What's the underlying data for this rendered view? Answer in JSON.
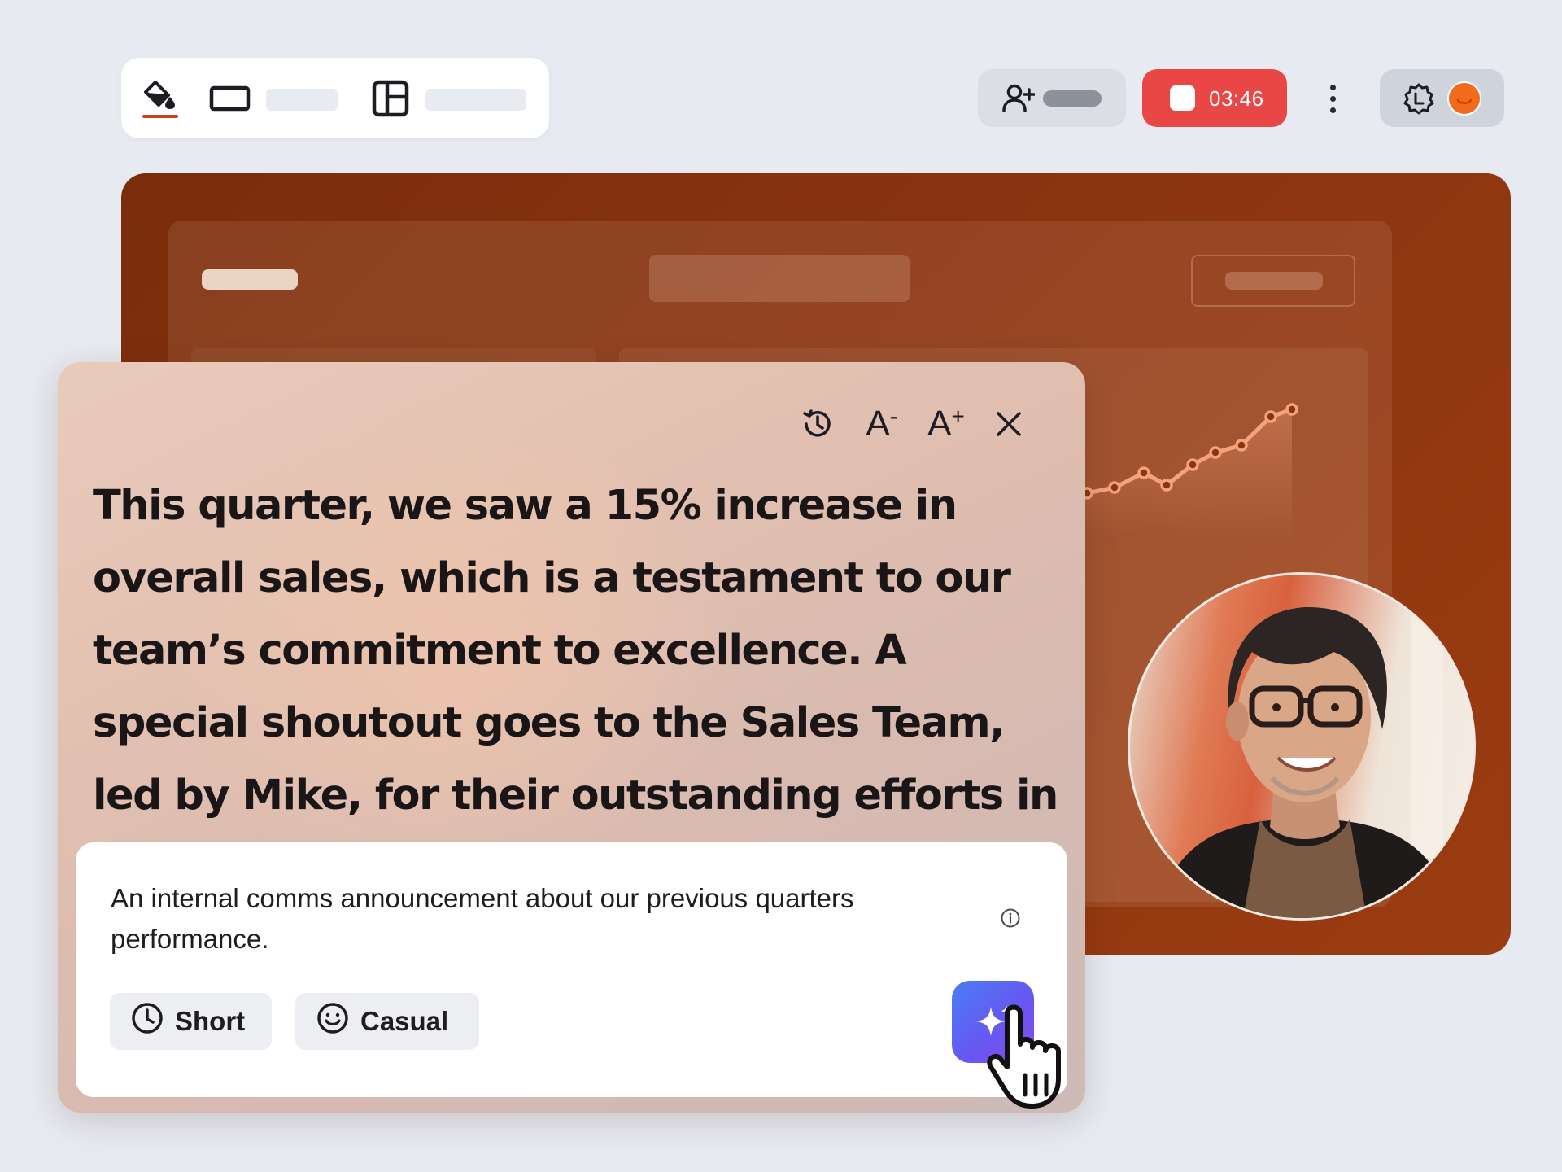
{
  "toolbar": {
    "items": [
      {
        "icon": "paint-bucket-icon"
      },
      {
        "icon": "aspect-ratio-icon"
      },
      {
        "icon": "layout-icon"
      }
    ]
  },
  "header": {
    "recording_time": "03:46",
    "recording_color": "#e94646",
    "invite_icon": "add-user-icon",
    "more_icon": "more-vertical-icon"
  },
  "presentation": {
    "accent": "#8a3410",
    "chart_line_color": "#f4a27a"
  },
  "teleprompter": {
    "tools": [
      "history-icon",
      "decrease-font-icon",
      "increase-font-icon",
      "close-icon"
    ],
    "decrease_label": "A",
    "increase_label": "A",
    "script": "This quarter, we saw a 15% increase in overall sales, which is a testament to our team’s commitment to excellence. A special shoutout goes to the Sales Team, led by Mike, for their outstanding efforts in securing new clients."
  },
  "composer": {
    "prompt": "An internal comms announcement about our previous quarters performance.",
    "chips": [
      {
        "label": "Short",
        "icon": "clock-icon"
      },
      {
        "label": "Casual",
        "icon": "smile-icon"
      }
    ],
    "generate_icon": "sparkle-icon",
    "generate_gradient": [
      "#4a7df5",
      "#8a49ec"
    ]
  }
}
